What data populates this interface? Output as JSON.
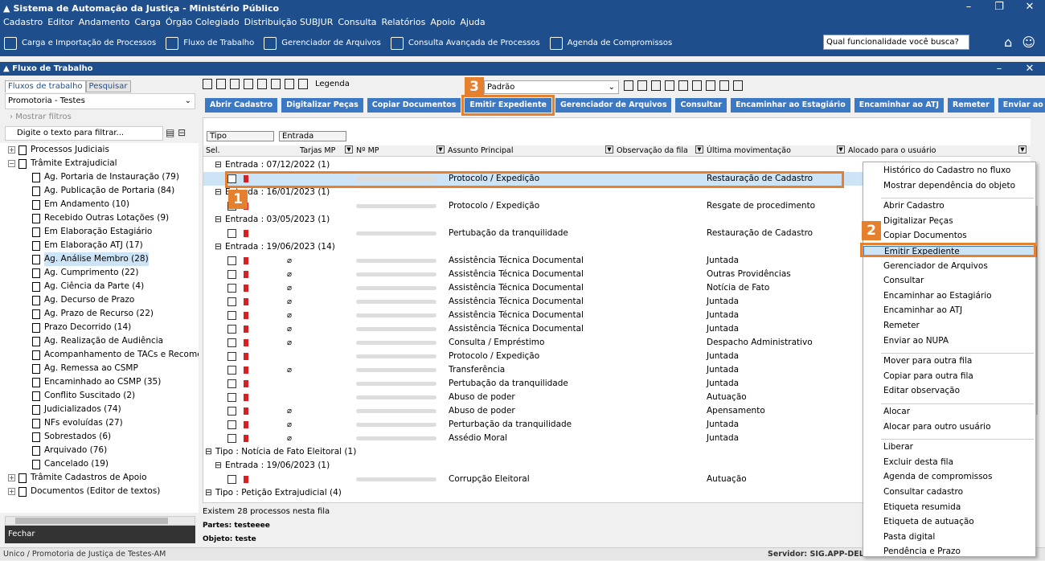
{
  "app": {
    "title": "Sistema de Automação da Justiça - Ministério Público",
    "minimize": "–",
    "restore": "❐",
    "close": "✕"
  },
  "menu": [
    "Cadastro",
    "Editor",
    "Andamento",
    "Carga",
    "Órgão Colegiado",
    "Distribuição SUBJUR",
    "Consulta",
    "Relatórios",
    "Apoio",
    "Ajuda"
  ],
  "toolbar": {
    "items": [
      "Carga e Importação de Processos",
      "Fluxo de Trabalho",
      "Gerenciador de Arquivos",
      "Consulta Avançada de Processos",
      "Agenda de Compromissos"
    ],
    "search_placeholder": "Qual funcionalidade você busca?"
  },
  "subwindow": {
    "title": "Fluxo de Trabalho",
    "minimize": "–",
    "close": "✕"
  },
  "left": {
    "tabs": [
      "Fluxos de trabalho",
      "Pesquisar"
    ],
    "combo": "Promotoria - Testes",
    "show_filters": "Mostrar filtros",
    "filter_placeholder": "Digite o texto para filtrar...",
    "fechar": "Fechar",
    "tree": [
      {
        "label": "Processos Judiciais",
        "level": 0,
        "exp": "+"
      },
      {
        "label": "Trâmite Extrajudicial",
        "level": 0,
        "exp": "−"
      },
      {
        "label": "Ag. Portaria de Instauração (79)",
        "level": 1
      },
      {
        "label": "Ag. Publicação de Portaria (84)",
        "level": 1
      },
      {
        "label": "Em Andamento (10)",
        "level": 1
      },
      {
        "label": "Recebido Outras Lotações (9)",
        "level": 1
      },
      {
        "label": "Em Elaboração Estagiário",
        "level": 1
      },
      {
        "label": "Em Elaboração ATJ (17)",
        "level": 1
      },
      {
        "label": "Ag. Análise Membro (28)",
        "level": 1,
        "sel": true
      },
      {
        "label": "Ag. Cumprimento (22)",
        "level": 1
      },
      {
        "label": "Ag. Ciência da Parte (4)",
        "level": 1
      },
      {
        "label": "Ag. Decurso de Prazo",
        "level": 1
      },
      {
        "label": "Ag. Prazo de Recurso (22)",
        "level": 1
      },
      {
        "label": "Prazo Decorrido (14)",
        "level": 1
      },
      {
        "label": "Ag. Realização de Audiência",
        "level": 1
      },
      {
        "label": "Acompanhamento de TACs e Recomendaç",
        "level": 1
      },
      {
        "label": "Ag. Remessa ao CSMP",
        "level": 1
      },
      {
        "label": "Encaminhado ao CSMP (35)",
        "level": 1
      },
      {
        "label": "Conflito Suscitado (2)",
        "level": 1
      },
      {
        "label": "Judicializados (74)",
        "level": 1
      },
      {
        "label": "NFs evoluídas (27)",
        "level": 1
      },
      {
        "label": "Sobrestados (6)",
        "level": 1
      },
      {
        "label": "Arquivado (76)",
        "level": 1
      },
      {
        "label": "Cancelado (19)",
        "level": 1
      },
      {
        "label": "Trâmite Cadastros de Apoio",
        "level": 0,
        "exp": "+"
      },
      {
        "label": "Documentos (Editor de textos)",
        "level": 0,
        "exp": "+"
      }
    ]
  },
  "main": {
    "legenda": "Legenda",
    "layout": "Padrão",
    "buttons": [
      "Abrir Cadastro",
      "Digitalizar Peças",
      "Copiar Documentos",
      "Emitir Expediente",
      "Gerenciador de Arquivos",
      "Consultar",
      "Encaminhar ao Estagiário",
      "Encaminhar ao ATJ",
      "Remeter",
      "Enviar ao NUPA"
    ],
    "group_chips": [
      "Tipo",
      "Entrada"
    ],
    "columns": [
      "Sel.",
      "Tarjas MP",
      "Nº MP",
      "Assunto Principal",
      "Observação da fila",
      "Última movimentação",
      "Alocado para o usuário"
    ],
    "groups": [
      {
        "type": "grp",
        "label": "Entrada : 07/12/2022  (1)",
        "indent": 1
      },
      {
        "type": "row",
        "assunto": "Protocolo / Expedição",
        "mov": "Restauração de Cadastro",
        "sel": true
      },
      {
        "type": "grp",
        "label": "Entrada : 16/01/2023  (1)",
        "indent": 1
      },
      {
        "type": "row",
        "assunto": "Protocolo / Expedição",
        "mov": "Resgate de procedimento"
      },
      {
        "type": "grp",
        "label": "Entrada : 03/05/2023  (1)",
        "indent": 1
      },
      {
        "type": "row",
        "assunto": "Pertubação da tranquilidade",
        "mov": "Restauração de Cadastro"
      },
      {
        "type": "grp",
        "label": "Entrada : 19/06/2023  (14)",
        "indent": 1
      },
      {
        "type": "row",
        "assunto": "Assistência Técnica Documental",
        "mov": "Juntada",
        "clip": true
      },
      {
        "type": "row",
        "assunto": "Assistência Técnica Documental",
        "mov": "Outras Providências",
        "clip": true
      },
      {
        "type": "row",
        "assunto": "Assistência Técnica Documental",
        "mov": "Notícia de Fato",
        "clip": true
      },
      {
        "type": "row",
        "assunto": "Assistência Técnica Documental",
        "mov": "Juntada",
        "clip": true
      },
      {
        "type": "row",
        "assunto": "Assistência Técnica Documental",
        "mov": "Juntada",
        "clip": true
      },
      {
        "type": "row",
        "assunto": "Assistência Técnica Documental",
        "mov": "Juntada",
        "clip": true
      },
      {
        "type": "row",
        "assunto": "Consulta / Empréstimo",
        "mov": "Despacho Administrativo",
        "clip": true
      },
      {
        "type": "row",
        "assunto": "Protocolo / Expedição",
        "mov": "Juntada"
      },
      {
        "type": "row",
        "assunto": "Transferência",
        "mov": "Juntada",
        "clip": true
      },
      {
        "type": "row",
        "assunto": "Pertubação da tranquilidade",
        "mov": "Juntada"
      },
      {
        "type": "row",
        "assunto": "Abuso de poder",
        "mov": "Autuação"
      },
      {
        "type": "row",
        "assunto": "Abuso de poder",
        "mov": "Apensamento",
        "clip": true
      },
      {
        "type": "row",
        "assunto": "Perturbação da tranquilidade",
        "mov": "Juntada",
        "clip": true
      },
      {
        "type": "row",
        "assunto": "Assédio Moral",
        "mov": "Juntada",
        "clip": true
      },
      {
        "type": "grp",
        "label": "Tipo : Notícia de Fato Eleitoral  (1)",
        "indent": 0
      },
      {
        "type": "grp",
        "label": "Entrada : 19/06/2023  (1)",
        "indent": 1
      },
      {
        "type": "row",
        "assunto": "Corrupção Eleitoral",
        "mov": "Autuação"
      },
      {
        "type": "grp",
        "label": "Tipo : Petição Extrajudicial  (4)",
        "indent": 0
      }
    ],
    "footer": {
      "count": "Existem 28 processos nesta fila",
      "partes": "Partes: testeeee",
      "objeto": "Objeto: teste"
    }
  },
  "context_menu": [
    {
      "label": "Histórico do Cadastro no fluxo"
    },
    {
      "label": "Mostrar dependência do objeto"
    },
    {
      "sep": true
    },
    {
      "label": "Abrir Cadastro"
    },
    {
      "label": "Digitalizar Peças"
    },
    {
      "label": "Copiar Documentos"
    },
    {
      "label": "Emitir Expediente",
      "hl": true
    },
    {
      "label": "Gerenciador de Arquivos"
    },
    {
      "label": "Consultar"
    },
    {
      "label": "Encaminhar ao Estagiário"
    },
    {
      "label": "Encaminhar ao ATJ"
    },
    {
      "label": "Remeter"
    },
    {
      "label": "Enviar ao NUPA"
    },
    {
      "sep": true
    },
    {
      "label": "Mover para outra fila"
    },
    {
      "label": "Copiar para outra fila"
    },
    {
      "label": "Editar observação"
    },
    {
      "sep": true
    },
    {
      "label": "Alocar"
    },
    {
      "label": "Alocar para outro usuário"
    },
    {
      "sep": true
    },
    {
      "label": "Liberar"
    },
    {
      "label": "Excluir desta fila"
    },
    {
      "label": "Agenda de compromissos"
    },
    {
      "label": "Consultar cadastro"
    },
    {
      "label": "Etiqueta resumida"
    },
    {
      "label": "Etiqueta de autuação"
    },
    {
      "label": "Pasta digital"
    },
    {
      "label": "Pendência e Prazo"
    }
  ],
  "badges": [
    "1",
    "2",
    "3"
  ],
  "status": {
    "left": "Unico / Promotoria de Justiça de Testes-AM",
    "server": "Servidor: SIG.APP-DELPHI"
  },
  "colors": {
    "accent": "#1f4e8c",
    "button": "#3c79c5",
    "highlight": "#e5802f",
    "flag": "#d52121"
  }
}
